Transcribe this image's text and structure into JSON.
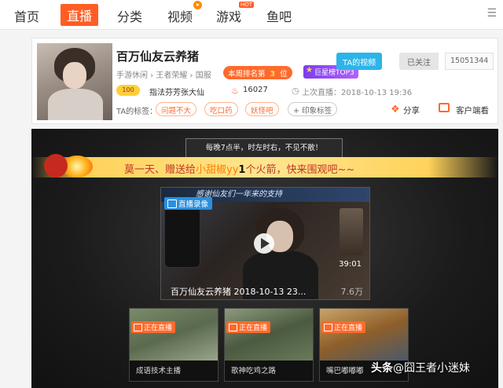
{
  "nav": {
    "items": [
      "首页",
      "直播",
      "分类",
      "视频",
      "游戏",
      "鱼吧"
    ],
    "active": "直播",
    "hot_badge": "HOT"
  },
  "room": {
    "title": "百万仙友云养猪",
    "breadcrumb": "手游休闲 › 王者荣耀 › 国服",
    "rank_label": "本周排名第",
    "rank_num": "3",
    "rank_unit": "位",
    "top3_badge": "巨星榜TOP3",
    "level_label": "100",
    "owner": "指法芬芳张大仙",
    "heat": "16027",
    "last_live_label": "上次直播：",
    "last_live_time": "2018-10-13 19:36",
    "tags_label": "TA的标签：",
    "tags": [
      "问题不大",
      "吃口药",
      "妖怪吧"
    ],
    "add_tag": "+ 印象标签",
    "video_button": "TA的视频",
    "follow_button": "已关注",
    "follow_count": "15051344",
    "share": "分享",
    "client": "客户端看"
  },
  "player": {
    "schedule": "每晚7点半，时左时右，不见不散！",
    "rocket_msg": {
      "pre": "莫一天、赠送给",
      "target": "小甜椒yy",
      "count": "1",
      "post": "个火箭，快来围观吧~~"
    },
    "replay": {
      "badge": "直播录像",
      "banner": "感谢仙友们一年来的支持",
      "duration": "39:01",
      "title": "百万仙友云养猪 2018-10-13 23...",
      "views": "7.6万"
    },
    "recommend": [
      {
        "badge": "正在直播",
        "name": "成语技术主播"
      },
      {
        "badge": "正在直播",
        "name": "歌神吃鸡之路"
      },
      {
        "badge": "正在直播",
        "name": "嘴巴嘟嘟嘟"
      }
    ]
  },
  "watermark": {
    "brand": "头条",
    "handle": "@囧王者小迷妹"
  },
  "colors": {
    "accent": "#ff5d23",
    "blue": "#2db4e8",
    "rocket_bar": "#ffe58f"
  }
}
